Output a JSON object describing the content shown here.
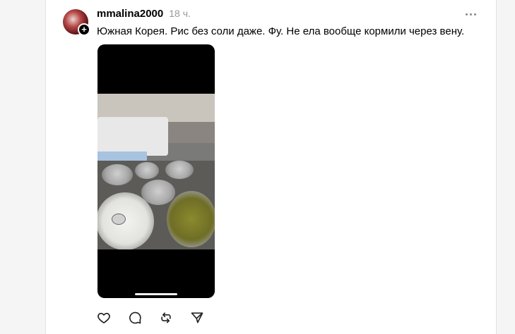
{
  "post": {
    "username": "mmalina2000",
    "timestamp": "18 ч.",
    "text": "Южная Корея. Рис без соли даже. Фу. Не ела вообще кормили через вену.",
    "follow_badge": "+",
    "media_type": "video",
    "media_description_icon": "hospital-food-tray-photo"
  },
  "icons": {
    "more": "more-horizontal-icon",
    "like": "heart-icon",
    "comment": "comment-bubble-icon",
    "repost": "repost-icon",
    "share": "send-icon"
  },
  "colors": {
    "text": "#000000",
    "muted": "#999999",
    "background": "#f5f5f5",
    "card": "#ffffff"
  }
}
